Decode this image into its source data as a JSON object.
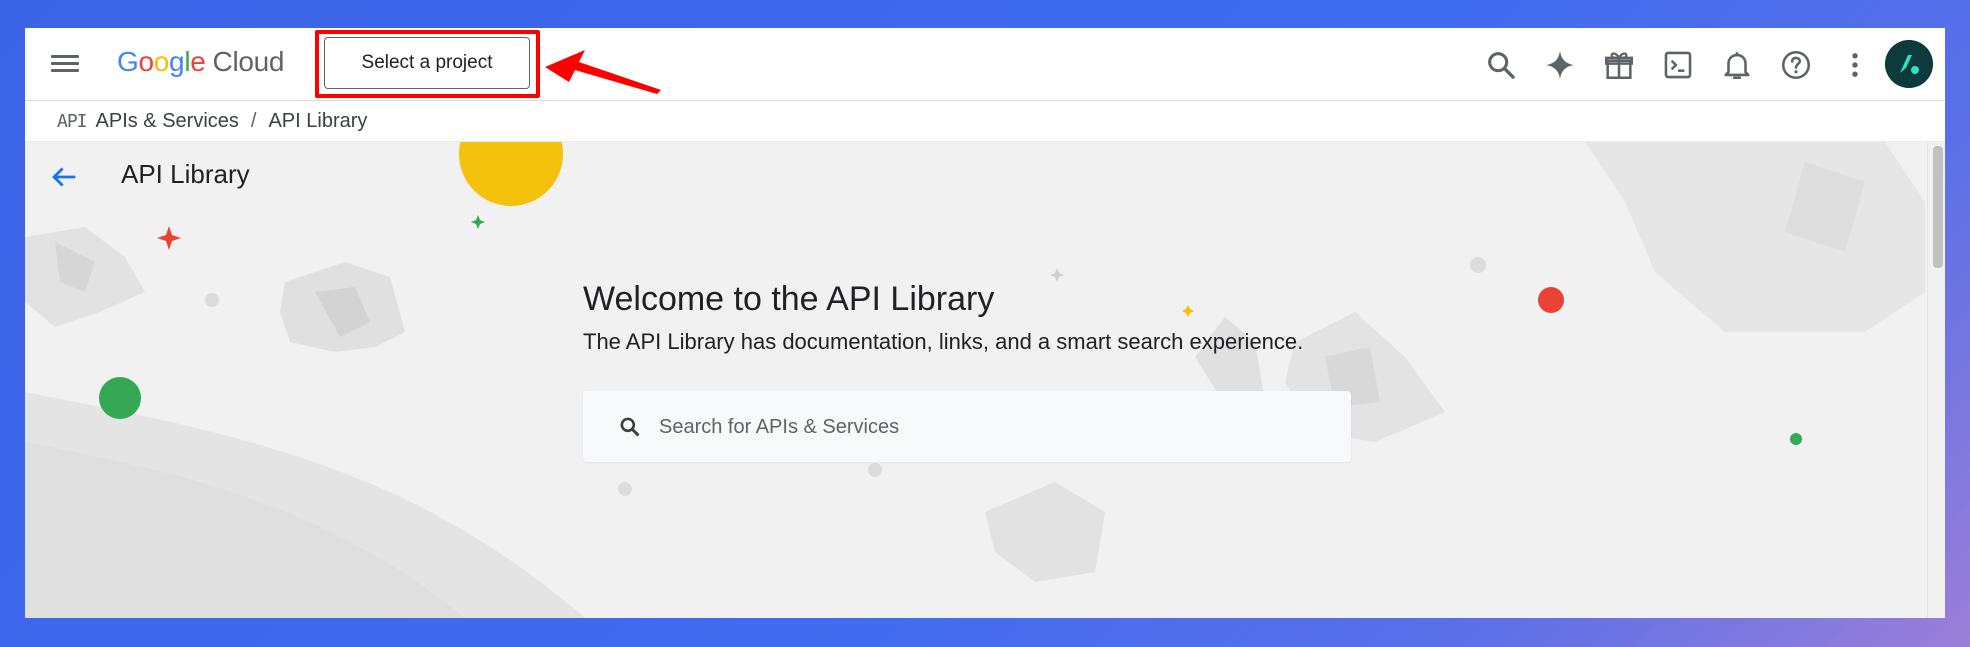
{
  "header": {
    "logo_google": [
      "G",
      "o",
      "o",
      "g",
      "l",
      "e"
    ],
    "logo_cloud": "Cloud",
    "project_selector_label": "Select a project",
    "icons": [
      "search-icon",
      "gemini-sparkle-icon",
      "gift-icon",
      "cloud-shell-icon",
      "notifications-icon",
      "help-icon",
      "more-vert-icon"
    ],
    "highlight_color": "#ff0000"
  },
  "breadcrumb": {
    "badge": "API",
    "items": [
      "APIs & Services",
      "API Library"
    ],
    "separator": "/"
  },
  "main": {
    "page_title": "API Library",
    "welcome_title": "Welcome to the API Library",
    "welcome_subtitle": "The API Library has documentation, links, and a smart search experience.",
    "search_placeholder": "Search for APIs & Services"
  },
  "colors": {
    "accent_blue": "#1a73e8",
    "background": "#f1f1f1"
  }
}
